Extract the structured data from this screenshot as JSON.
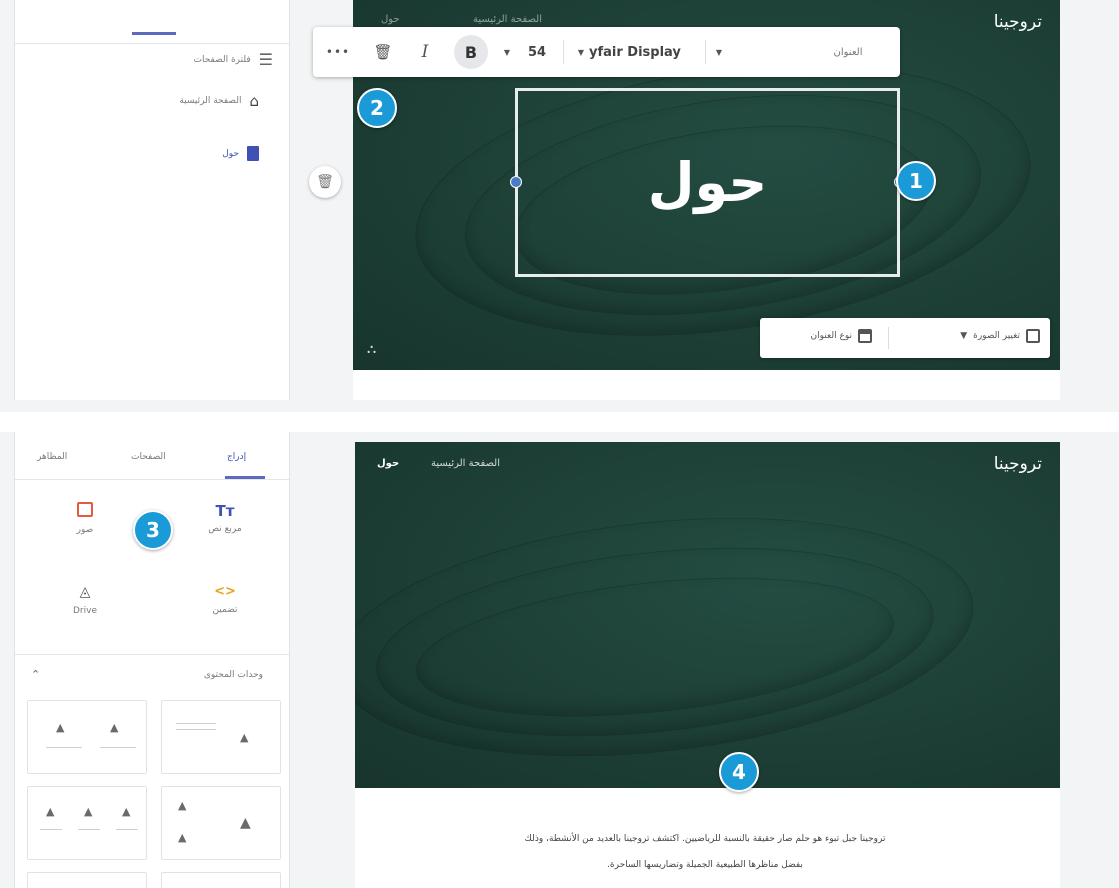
{
  "top_panel": {
    "sidebar": {
      "filter_label": "فلترة الصفحات",
      "pages": [
        {
          "label": "الصفحة الرئيسية",
          "icon": "home-icon"
        },
        {
          "label": "حول",
          "icon": "page-icon"
        }
      ]
    },
    "site_title": "تروجينا",
    "faded_nav": "الصفحة الرئيسية",
    "faded_nav2": "حول",
    "toolbar": {
      "more": "•••",
      "italic": "I",
      "bold": "B",
      "font_size": "54",
      "font_name": "yfair Display",
      "style_label": "العنوان"
    },
    "heading_text": "حول",
    "change_image_label": "تغيير الصورة",
    "header_type_label": "نوع العنوان",
    "callouts": [
      "1",
      "2"
    ]
  },
  "bottom_panel": {
    "tabs": [
      {
        "label": "إدراج",
        "active": true
      },
      {
        "label": "الصفحات",
        "active": false
      },
      {
        "label": "المظاهر",
        "active": false
      }
    ],
    "insert_items": [
      {
        "label": "مربع نص",
        "icon": "Tт"
      },
      {
        "label": "صور",
        "icon": "image-icon"
      },
      {
        "label": "تضمين",
        "icon": "<>"
      },
      {
        "label": "Drive",
        "icon": "drive-icon"
      }
    ],
    "layouts_label": "وحدات المحتوى",
    "site_title": "تروجينا",
    "nav": [
      {
        "label": "الصفحة الرئيسية"
      },
      {
        "label": "حول"
      }
    ],
    "body_text_line1": "تروجينا جبل تبوء هو حلم صار حقيقة بالنسبة للرياضيين. اكتشف تروجينا بالعديد من الأنشطة، وذلك",
    "body_text_line2": "بفضل مناظرها الطبيعية الجميلة وتضاريسها الساحرة.",
    "callouts": [
      "3",
      "4"
    ]
  },
  "colors": {
    "hero_green": "#1d3f36",
    "callout_blue": "#1a9ad6",
    "accent_blue": "#4b7bc4"
  }
}
